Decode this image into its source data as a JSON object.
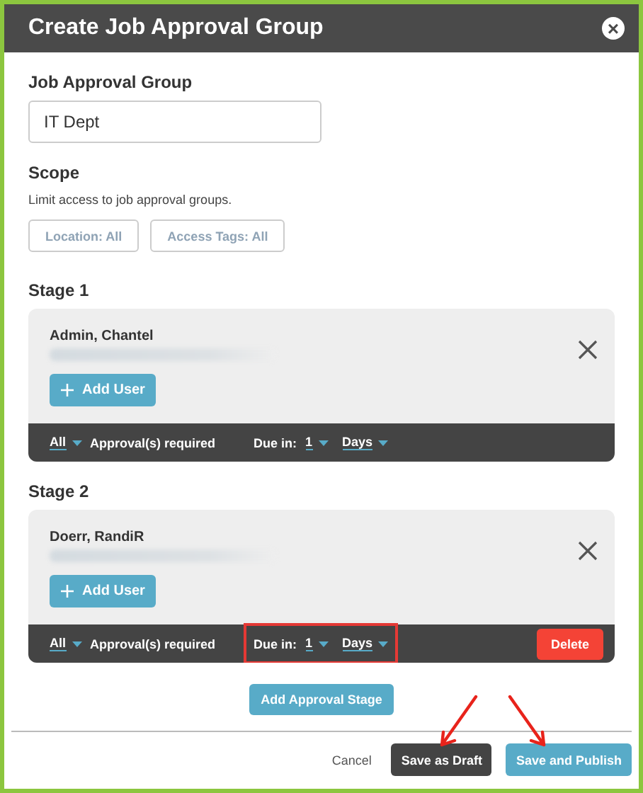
{
  "dialog": {
    "title": "Create Job Approval Group",
    "close_label": "×"
  },
  "group_field": {
    "label": "Job Approval Group",
    "value": "IT Dept"
  },
  "scope": {
    "heading": "Scope",
    "hint": "Limit access to job approval groups.",
    "filters": [
      "Location: All",
      "Access Tags: All"
    ]
  },
  "stages": [
    {
      "heading": "Stage 1",
      "user": "Admin, Chantel",
      "add_user": "Add User",
      "approvals": "All",
      "approvals_label": "Approval(s) required",
      "due_label": "Due in:",
      "due_value": "1",
      "due_unit": "Days",
      "highlighted": false
    },
    {
      "heading": "Stage 2",
      "user": "Doerr, RandiR",
      "add_user": "Add User",
      "approvals": "All",
      "approvals_label": "Approval(s) required",
      "due_label": "Due in:",
      "due_value": "1",
      "due_unit": "Days",
      "highlighted": true,
      "delete": "Delete"
    }
  ],
  "add_stage": "Add Approval Stage",
  "footer_buttons": [
    {
      "label": "Cancel",
      "kind": "link",
      "arrow": false
    },
    {
      "label": "Save as Draft",
      "kind": "dark",
      "arrow": true
    },
    {
      "label": "Save and Publish",
      "kind": "primary",
      "arrow": true
    }
  ]
}
